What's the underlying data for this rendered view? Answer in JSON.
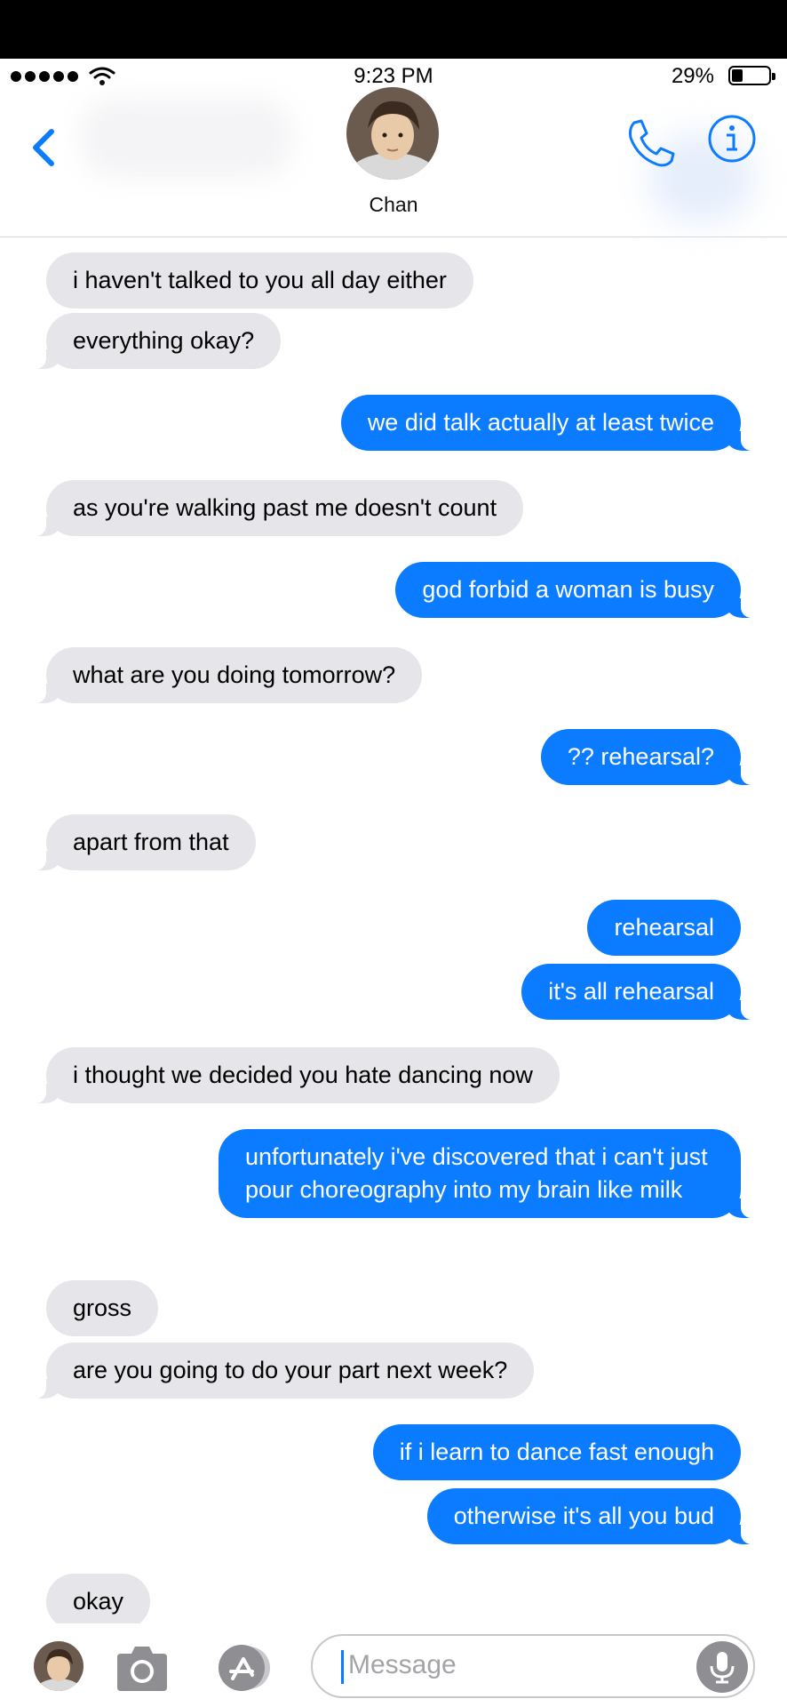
{
  "status": {
    "time": "9:23 PM",
    "battery": "29%",
    "battery_level": 0.29
  },
  "header": {
    "contact_name": "Chan"
  },
  "messages": [
    {
      "from": "contact",
      "text": "i haven't talked to you all day either"
    },
    {
      "from": "contact",
      "text": "everything okay?"
    },
    {
      "from": "me",
      "text": "we did talk actually at least twice"
    },
    {
      "from": "contact",
      "text": "as you're walking past me doesn't count"
    },
    {
      "from": "me",
      "text": "god forbid a woman is busy"
    },
    {
      "from": "contact",
      "text": "what are you doing tomorrow?"
    },
    {
      "from": "me",
      "text": "?? rehearsal?"
    },
    {
      "from": "contact",
      "text": "apart from that"
    },
    {
      "from": "me",
      "text": "rehearsal"
    },
    {
      "from": "me",
      "text": "it's all rehearsal"
    },
    {
      "from": "contact",
      "text": "i thought we decided you hate dancing now"
    },
    {
      "from": "me",
      "text": "unfortunately i've discovered that i can't just pour choreography into my brain like milk"
    },
    {
      "from": "contact",
      "text": "gross"
    },
    {
      "from": "contact",
      "text": "are you going to do your part next week?"
    },
    {
      "from": "me",
      "text": "if i learn to dance fast enough"
    },
    {
      "from": "me",
      "text": "otherwise it's all you bud"
    },
    {
      "from": "contact",
      "text": "okay"
    }
  ],
  "input": {
    "placeholder": "Message"
  },
  "icons": {
    "back": "chevron-left-icon",
    "call": "phone-icon",
    "info": "info-icon",
    "camera": "camera-icon",
    "apps": "app-store-icon",
    "mic": "microphone-icon"
  },
  "colors": {
    "sent_bubble": "#0b7cff",
    "received_bubble": "#e5e5ea",
    "accent": "#0b7cff"
  }
}
